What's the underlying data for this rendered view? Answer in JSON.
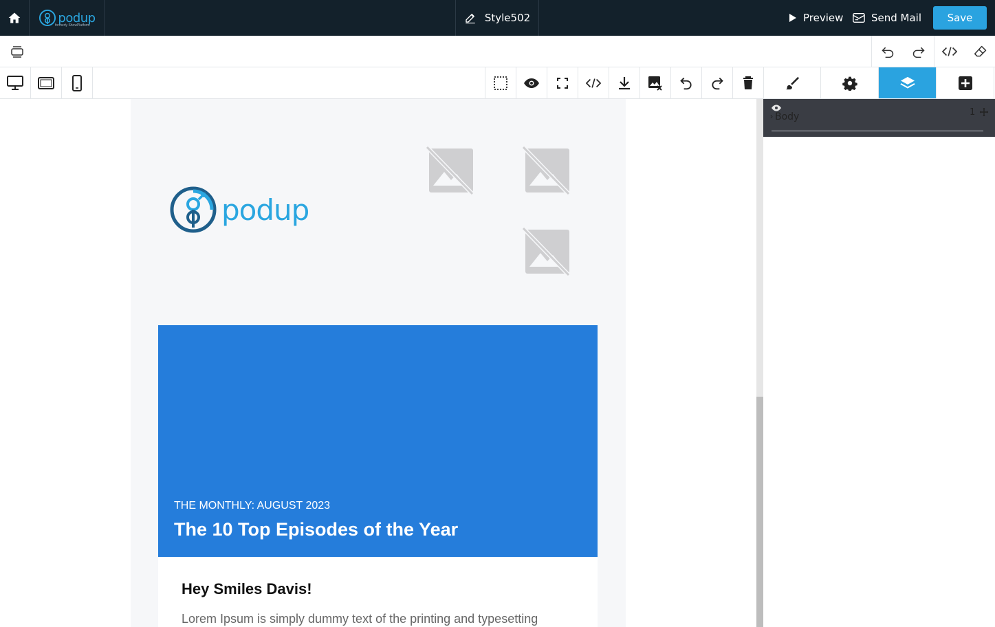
{
  "topbar": {
    "brand_word": "podup",
    "brand_subtitle": "formerly ShowPlatform",
    "document_title": "Style502",
    "preview_label": "Preview",
    "send_mail_label": "Send Mail",
    "save_label": "Save"
  },
  "email": {
    "logo_word": "podup",
    "hero_eyebrow": "THE MONTHLY: AUGUST 2023",
    "hero_headline": "The 10 Top Episodes of the Year",
    "hero_color": "#257ddb",
    "greeting": "Hey Smiles Davis!",
    "paragraph": "Lorem Ipsum is simply dummy text of the printing and typesetting"
  },
  "panel": {
    "active_tab": "layer-manager",
    "layers": [
      {
        "name": "Body",
        "count": "1"
      }
    ]
  },
  "colors": {
    "topbar_bg": "#13212b",
    "accent": "#2aa3e0",
    "brand": "#2aa6e0"
  }
}
